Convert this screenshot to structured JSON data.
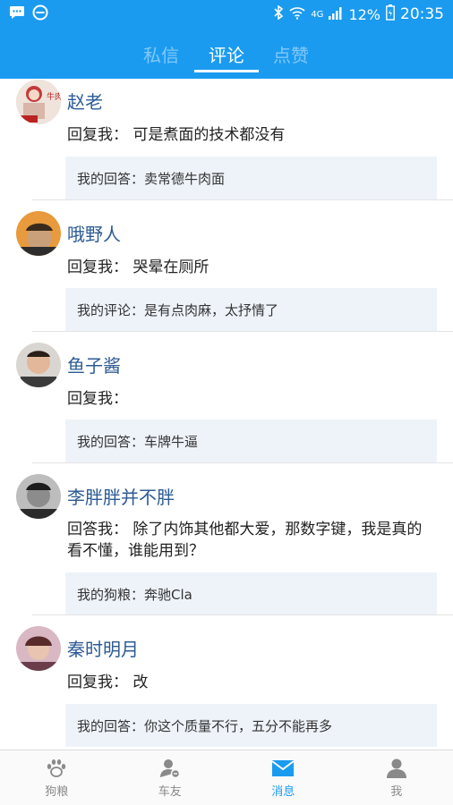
{
  "status_bar": {
    "network": "4G",
    "battery": "12%",
    "time": "20:35",
    "left_icons": [
      "message-bubble-icon",
      "blocked-icon"
    ],
    "right_icons": [
      "bluetooth-icon",
      "wifi-icon",
      "signal-icon",
      "battery-icon"
    ]
  },
  "tabs": [
    {
      "label": "私信",
      "active": false
    },
    {
      "label": "评论",
      "active": true
    },
    {
      "label": "点赞",
      "active": false
    }
  ],
  "comments": [
    {
      "name": "赵老",
      "reply": "回复我： 可是煮面的技术都没有",
      "quote": "我的回答：卖常德牛肉面",
      "avatar_text": "牛肉"
    },
    {
      "name": "哦野人",
      "reply": "回复我： 哭晕在厕所",
      "quote": "我的评论：是有点肉麻，太抒情了",
      "avatar_text": ""
    },
    {
      "name": "鱼子酱",
      "reply": "回复我：",
      "quote": "我的回答：车牌牛逼",
      "avatar_text": ""
    },
    {
      "name": "李胖胖并不胖",
      "reply": "回答我： 除了内饰其他都大爱，那数字键，我是真的看不懂，谁能用到？",
      "quote": "我的狗粮：奔驰Cla",
      "avatar_text": ""
    },
    {
      "name": "秦时明月",
      "reply": "回复我：  改",
      "quote": "我的回答：你这个质量不行，五分不能再多",
      "avatar_text": ""
    }
  ],
  "bottom_nav": [
    {
      "label": "狗粮",
      "icon": "paw-icon",
      "active": false
    },
    {
      "label": "车友",
      "icon": "car-friend-icon",
      "active": false
    },
    {
      "label": "消息",
      "icon": "mail-icon",
      "active": true
    },
    {
      "label": "我",
      "icon": "person-icon",
      "active": false
    }
  ],
  "colors": {
    "primary": "#1a9bf0",
    "name_text": "#2c5b94",
    "quote_bg": "#eef3fa"
  }
}
